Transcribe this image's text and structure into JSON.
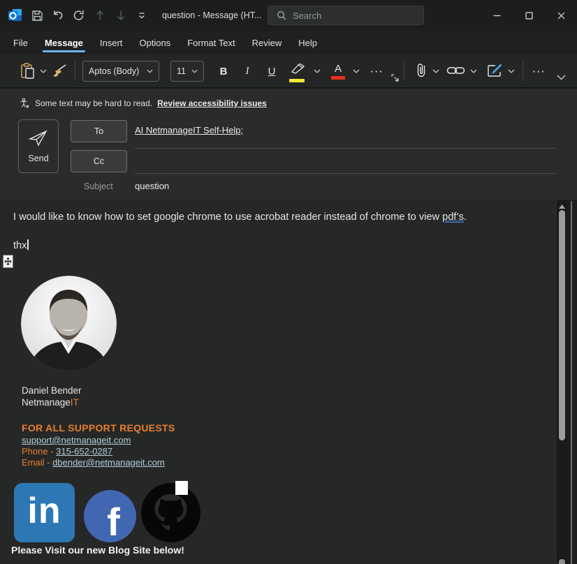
{
  "window": {
    "title": "question  -  Message (HT...",
    "search_placeholder": "Search"
  },
  "menu": {
    "items": [
      "File",
      "Message",
      "Insert",
      "Options",
      "Format Text",
      "Review",
      "Help"
    ],
    "active": "Message"
  },
  "ribbon": {
    "font_name": "Aptos (Body)",
    "font_size": "11",
    "bold": "B",
    "italic": "I",
    "underline": "U",
    "more": "···"
  },
  "a11y": {
    "text": "Some text may be hard to read.",
    "link": "Review accessibility issues"
  },
  "compose": {
    "send": "Send",
    "to": "To",
    "cc": "Cc",
    "to_value": "AI NetmanageIT Self-Help;",
    "subject_label": "Subject",
    "subject_value": "question"
  },
  "body": {
    "text_before": "I would like to know how to set google chrome to use acrobat reader instead of chrome to view ",
    "flagged": "pdf’s",
    "text_after": ".",
    "sign_off": "thx"
  },
  "signature": {
    "name": "Daniel Bender",
    "company_prefix": "Netmanage",
    "company_accent": "IT",
    "heading": "FOR ALL SUPPORT REQUESTS",
    "support_email": "support@netmanageit.com",
    "phone_label": "Phone - ",
    "phone": "315-652-0287",
    "email_label": "Email - ",
    "email": "dbender@netmanageit.com",
    "blog": "Please Visit our new Blog Site below!",
    "social": {
      "linkedin_label": "in",
      "facebook_label": "f"
    }
  },
  "colors": {
    "accent_blue": "#6cb4ee",
    "orange": "#e87d2e",
    "link_blue": "#b4cdd8",
    "grammar_blue": "#4a7fd4",
    "highlight_yellow": "#f5e636",
    "font_color_red": "#e8301d",
    "linkedin_blue": "#2d78b4",
    "facebook_blue": "#4267b2"
  }
}
